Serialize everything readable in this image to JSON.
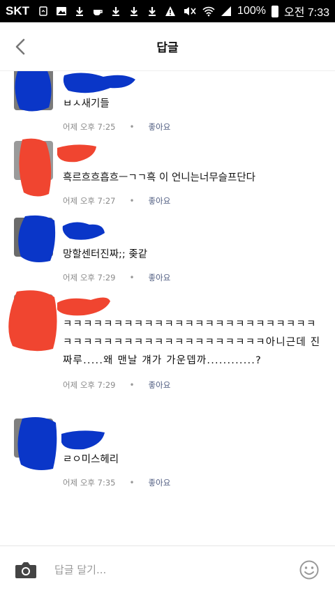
{
  "status_bar": {
    "carrier": "SKT",
    "battery_percent": "100%",
    "time": "오전 7:33",
    "icons": [
      "screenshot-icon",
      "gallery-icon",
      "download-icon",
      "coffee-icon",
      "download-icon",
      "download-icon",
      "download-icon",
      "warning-icon",
      "mute-icon",
      "wifi-icon",
      "signal-icon",
      "battery-icon"
    ]
  },
  "header": {
    "title": "답글",
    "back_icon": "chevron-left-icon"
  },
  "comments": [
    {
      "text": "ㅂㅅ새기들",
      "time": "어제 오후 7:25",
      "like": "좋아요",
      "blot_color": "#0a36c8"
    },
    {
      "text": "흑르흐흐흡흐ㅡㄱㄱ흑 이 언니는너무슬프단다",
      "time": "어제 오후 7:27",
      "like": "좋아요",
      "blot_color": "#f04530"
    },
    {
      "text": "망할센터진짜;; 좆같",
      "time": "어제 오후 7:29",
      "like": "좋아요",
      "blot_color": "#0a36c8"
    },
    {
      "text": "ㅋㅋㅋㅋㅋㅋㅋㅋㅋㅋㅋㅋㅋㅋㅋㅋㅋㅋㅋㅋㅋㅋㅋㅋㅋㅋㅋㅋㅋㅋㅋㅋㅋㅋㅋㅋㅋㅋㅋㅋㅋㅋㅋㅋㅋ아니근데 진짜루.....왜 맨날 걔가 가운뎁까............?",
      "time": "어제 오후 7:29",
      "like": "좋아요",
      "blot_color": "#f04530"
    },
    {
      "text": "ㄹㅇ미스헤리",
      "time": "어제 오후 7:35",
      "like": "좋아요",
      "blot_color": "#0a36c8"
    }
  ],
  "bottom_bar": {
    "placeholder": "답글 달기...",
    "camera_icon": "camera-icon",
    "emoji_icon": "smiley-icon"
  }
}
